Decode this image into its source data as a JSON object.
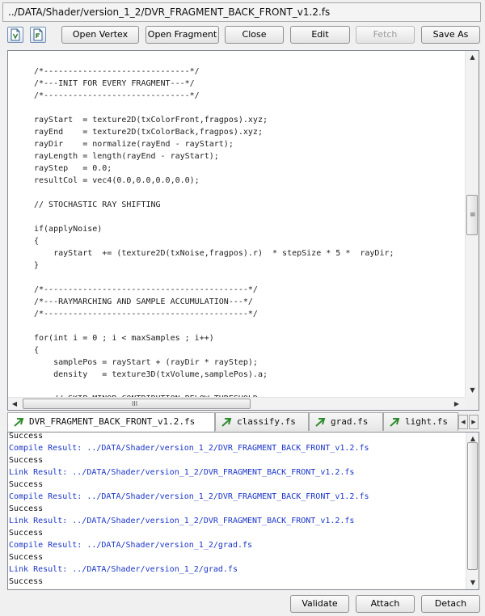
{
  "path": "../DATA/Shader/version_1_2/DVR_FRAGMENT_BACK_FRONT_v1.2.fs",
  "colors": {
    "log_link": "#1a35c8",
    "log_text": "#111111",
    "tab_icon": "#2e8b2e"
  },
  "toolbar": {
    "icon_buttons": [
      {
        "icon": "vertex-shader-file-icon"
      },
      {
        "icon": "fragment-shader-file-icon"
      }
    ],
    "buttons": [
      {
        "label": "Open Vertex",
        "enabled": true
      },
      {
        "label": "Open Fragment",
        "enabled": true
      },
      {
        "label": "Close",
        "enabled": true
      },
      {
        "label": "Edit",
        "enabled": true
      },
      {
        "label": "Fetch",
        "enabled": false
      },
      {
        "label": "Save As",
        "enabled": true
      }
    ]
  },
  "editor": {
    "lines": [
      "/*------------------------------*/",
      "/*---INIT FOR EVERY FRAGMENT---*/",
      "/*------------------------------*/",
      "",
      "rayStart  = texture2D(txColorFront,fragpos).xyz;",
      "rayEnd    = texture2D(txColorBack,fragpos).xyz;",
      "rayDir    = normalize(rayEnd - rayStart);",
      "rayLength = length(rayEnd - rayStart);",
      "rayStep   = 0.0;",
      "resultCol = vec4(0.0,0.0,0.0,0.0);",
      "",
      "// STOCHASTIC RAY SHIFTING",
      "",
      "if(applyNoise)",
      "{",
      "    rayStart  += (texture2D(txNoise,fragpos).r)  * stepSize * 5 *  rayDir;",
      "}",
      "",
      "/*------------------------------------------*/",
      "/*---RAYMARCHING AND SAMPLE ACCUMULATION---*/",
      "/*------------------------------------------*/",
      "",
      "for(int i = 0 ; i < maxSamples ; i++)",
      "{",
      "    samplePos = rayStart + (rayDir * rayStep);",
      "    density   = texture3D(txVolume,samplePos).a;",
      "",
      "    // SKIP MINOR CONTRIBUTION BELOW THRESHOLD"
    ],
    "hscroll_grip": "III"
  },
  "tabs": [
    {
      "label": "DVR_FRAGMENT_BACK_FRONT_v1.2.fs",
      "active": true
    },
    {
      "label": "classify.fs",
      "active": false
    },
    {
      "label": "grad.fs",
      "active": false
    },
    {
      "label": "light.fs",
      "active": false
    }
  ],
  "log": [
    {
      "text": "Success",
      "kind": "text"
    },
    {
      "text": "Compile Result: ../DATA/Shader/version_1_2/DVR_FRAGMENT_BACK_FRONT_v1.2.fs",
      "kind": "link"
    },
    {
      "text": "Success",
      "kind": "text"
    },
    {
      "text": "Link Result: ../DATA/Shader/version_1_2/DVR_FRAGMENT_BACK_FRONT_v1.2.fs",
      "kind": "link"
    },
    {
      "text": "Success",
      "kind": "text"
    },
    {
      "text": "Compile Result: ../DATA/Shader/version_1_2/DVR_FRAGMENT_BACK_FRONT_v1.2.fs",
      "kind": "link"
    },
    {
      "text": "Success",
      "kind": "text"
    },
    {
      "text": "Link Result: ../DATA/Shader/version_1_2/DVR_FRAGMENT_BACK_FRONT_v1.2.fs",
      "kind": "link"
    },
    {
      "text": "Success",
      "kind": "text"
    },
    {
      "text": "Compile Result: ../DATA/Shader/version_1_2/grad.fs",
      "kind": "link"
    },
    {
      "text": "Success",
      "kind": "text"
    },
    {
      "text": "Link Result: ../DATA/Shader/version_1_2/grad.fs",
      "kind": "link"
    },
    {
      "text": "Success",
      "kind": "text"
    }
  ],
  "bottom_buttons": [
    {
      "label": "Validate"
    },
    {
      "label": "Attach"
    },
    {
      "label": "Detach"
    }
  ]
}
